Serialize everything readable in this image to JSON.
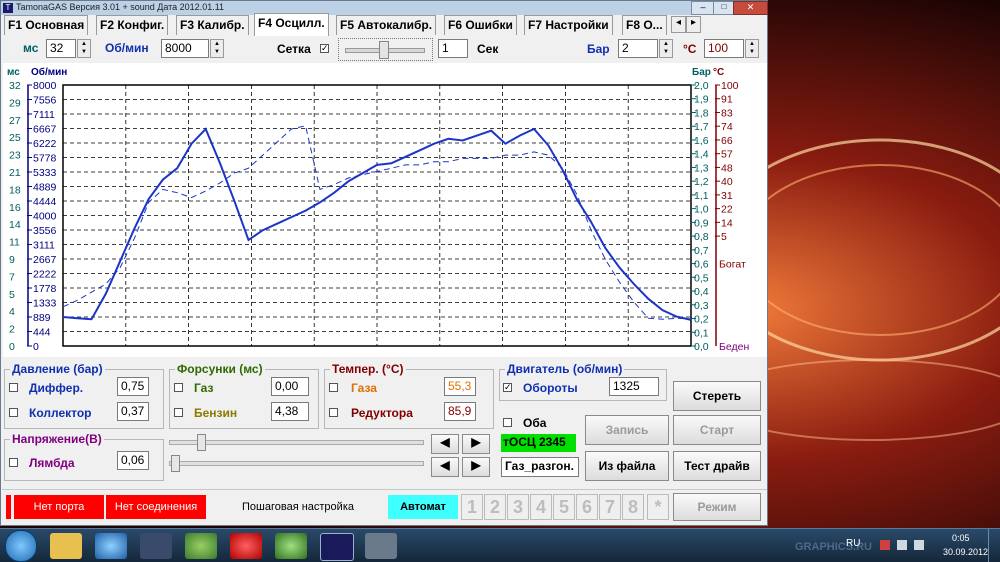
{
  "title": "TamonaGAS  Версия 3.01 + sound  Дата 2012.01.11",
  "tabs": [
    "F1 Основная",
    "F2 Конфиг.",
    "F3 Калибр.",
    "F4 Осцилл.",
    "F5 Автокалибр.",
    "F6 Ошибки",
    "F7 Настройки",
    "F8 О..."
  ],
  "top": {
    "ms_label": "мс",
    "ms_value": "32",
    "rpm_label": "Об/мин",
    "rpm_value": "8000",
    "grid_label": "Сетка",
    "grid_check": "✓",
    "sec_value": "1",
    "sec_label": "Сек",
    "bar_label": "Бар",
    "bar_value": "2",
    "c_label": "°С",
    "c_value": "100"
  },
  "axis_headers": {
    "ms": "мс",
    "rpm": "Об/мин",
    "bar": "Бар",
    "c": "°С"
  },
  "axis_ms": [
    "32",
    "29",
    "27",
    "25",
    "23",
    "21",
    "18",
    "16",
    "14",
    "11",
    "9",
    "7",
    "5",
    "4",
    "2",
    "0"
  ],
  "axis_rpm": [
    "8000",
    "7556",
    "7111",
    "6667",
    "6222",
    "5778",
    "5333",
    "4889",
    "4444",
    "4000",
    "3556",
    "3111",
    "2667",
    "2222",
    "1778",
    "1333",
    "889",
    "444",
    "0"
  ],
  "axis_bar": [
    "2,0",
    "1,9",
    "1,8",
    "1,7",
    "1,6",
    "1,4",
    "1,3",
    "1,2",
    "1,1",
    "1,0",
    "0,9",
    "0,8",
    "0,7",
    "0,6",
    "0,5",
    "0,4",
    "0,3",
    "0,2",
    "0,1",
    "0,0"
  ],
  "axis_c": [
    "100",
    "91",
    "83",
    "74",
    "66",
    "57",
    "48",
    "40",
    "31",
    "22",
    "14",
    "5"
  ],
  "rich": "Богат",
  "lean": "Беден",
  "chart_data": {
    "type": "line",
    "ylim": [
      0,
      8000
    ],
    "series": [
      {
        "values": [
          889,
          850,
          820,
          1600,
          2600,
          3600,
          4500,
          5100,
          5450,
          6200,
          6650,
          5600,
          4450,
          3250,
          3550,
          3750,
          3950,
          4150,
          4400,
          4700,
          5050,
          5300,
          5550,
          5600,
          5800,
          6000,
          6200,
          6350,
          6300,
          6450,
          6600,
          6200,
          6450,
          6650,
          6150,
          5400,
          4500,
          3800,
          3000,
          2400,
          1900,
          1450,
          1100,
          900,
          800
        ]
      },
      {
        "values": [
          1200,
          1400,
          1650,
          1900,
          2400,
          3300,
          4400,
          4800,
          4700,
          4550,
          4750,
          5000,
          5300,
          5450,
          5850,
          6250,
          6650,
          6750,
          4800,
          4950,
          5150,
          5250,
          5350,
          5450,
          5550,
          5550,
          5650,
          5650,
          5750,
          5750,
          5750,
          5850,
          5850,
          5950,
          5850,
          5450,
          4650,
          3550,
          2650,
          1950,
          1350,
          850,
          820,
          850,
          830
        ]
      }
    ]
  },
  "pressure": {
    "title": "Давление (бар)",
    "diff_label": "Диффер.",
    "diff_value": "0,75",
    "coll_label": "Коллектор",
    "coll_value": "0,37"
  },
  "injectors": {
    "title": "Форсунки (мс)",
    "gas_label": "Газ",
    "gas_value": "0,00",
    "petrol_label": "Бензин",
    "petrol_value": "4,38"
  },
  "temp": {
    "title": "Темпер. (°С)",
    "gas_label": "Газа",
    "gas_value": "55,3",
    "red_label": "Редуктора",
    "red_value": "85,9"
  },
  "engine": {
    "title": "Двигатель (об/мин)",
    "rpm_label": "Обороты",
    "rpm_value": "1325",
    "check": "✓"
  },
  "voltage": {
    "title": "Напряжение(В)",
    "lambda_label": "Лямбда",
    "lambda_value": "0,06"
  },
  "both_label": "Оба",
  "tosc_value": "тОСЦ 2345",
  "file_value": "Газ_разгон.",
  "buttons": {
    "erase": "Стереть",
    "record": "Запись",
    "start": "Старт",
    "from_file": "Из файла",
    "test_drive": "Тест драйв",
    "mode": "Режим"
  },
  "status": {
    "no_port": "Нет порта",
    "no_conn": "Нет соединения",
    "step": "Пошаговая настройка",
    "auto": "Автомат"
  },
  "num_buttons": [
    "1",
    "2",
    "3",
    "4",
    "5",
    "6",
    "7",
    "8",
    "*"
  ],
  "taskbar": {
    "lang": "RU",
    "time": "0:05",
    "date": "30.09.2012",
    "watermark": "GRAPHICS.RU"
  },
  "colors": {
    "rpm_axis": "#000080",
    "bar_axis": "#006060",
    "c_axis": "#800000",
    "curve": "#1c35c8",
    "green": "#00e000",
    "red": "#ff0000",
    "cyan": "#40ffff"
  }
}
